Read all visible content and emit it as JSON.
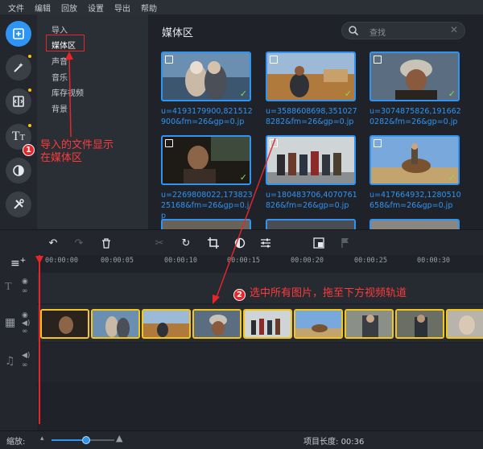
{
  "menu": [
    "文件",
    "编辑",
    "回放",
    "设置",
    "导出",
    "帮助"
  ],
  "rail": [
    {
      "icon": "import-media-icon",
      "active": true
    },
    {
      "icon": "magic-wand-icon",
      "dot": true
    },
    {
      "icon": "transitions-icon",
      "dot": true
    },
    {
      "icon": "titles-icon",
      "dot": true
    },
    {
      "icon": "filters-icon"
    },
    {
      "icon": "tools-icon"
    }
  ],
  "nav": {
    "items": [
      "导入",
      "媒体区",
      "声音",
      "音乐",
      "库存视频",
      "背景"
    ],
    "selected_index": 1
  },
  "annotations": {
    "a1": {
      "num": "1",
      "line1": "导入的文件显示",
      "line2": "在媒体区"
    },
    "a2": {
      "num": "2",
      "text": "选中所有图片，拖至下方视频轨道"
    }
  },
  "media": {
    "title": "媒体区",
    "search_placeholder": "查找",
    "clear_glyph": "✕",
    "items": [
      {
        "caption": "u=4193179900,821512900&fm=26&gp=0.jp",
        "checked": true
      },
      {
        "caption": "u=3588608698,3510278282&fm=26&gp=0.jp",
        "checked": true
      },
      {
        "caption": "u=3074875826,1916620282&fm=26&gp=0.jp",
        "checked": true
      },
      {
        "caption": "u=2269808022,17382325168&fm=26&gp=0.jp",
        "checked": true
      },
      {
        "caption": "u=180483706,4070761826&fm=26&gp=0.jp",
        "checked": true
      },
      {
        "caption": "u=417664932,1280510658&fm=26&gp=0.jp",
        "checked": true
      }
    ]
  },
  "toolbar": {
    "undo": "undo-icon",
    "redo": "redo-icon",
    "delete": "trash-icon",
    "cut": "scissors-icon",
    "rotate": "rotate-icon",
    "crop": "crop-icon",
    "color": "color-adjust-icon",
    "properties": "sliders-icon",
    "pip": "picture-in-picture-icon",
    "marker": "flag-icon"
  },
  "timeline": {
    "ticks": [
      "00:00:00",
      "00:00:05",
      "00:00:10",
      "00:00:15",
      "00:00:20",
      "00:00:25",
      "00:00:30"
    ],
    "clip_count": 9
  },
  "status": {
    "zoom_label": "缩放:",
    "zoom_level": 0.55,
    "project_length_label": "项目长度:",
    "project_length": "00:36"
  },
  "colors": {
    "accent": "#2f95f5",
    "annotation": "#e8262a",
    "clip_border": "#f5c518"
  }
}
